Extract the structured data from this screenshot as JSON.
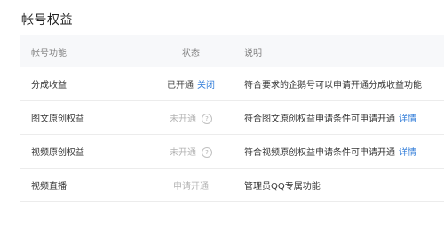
{
  "page": {
    "title": "帐号权益"
  },
  "table": {
    "headers": {
      "feature": "帐号功能",
      "status": "状态",
      "description": "说明"
    },
    "rows": [
      {
        "feature": "分成收益",
        "status": "已开通",
        "action": "关闭",
        "description": "符合要求的企鹅号可以申请开通分成收益功能"
      },
      {
        "feature": "图文原创权益",
        "status": "未开通",
        "help_icon": "question-circle-icon",
        "description": "符合图文原创权益申请条件可申请开通",
        "detail_link": "详情"
      },
      {
        "feature": "视频原创权益",
        "status": "未开通",
        "help_icon": "question-circle-icon",
        "description": "符合视频原创权益申请条件可申请开通",
        "detail_link": "详情"
      },
      {
        "feature": "视频直播",
        "status": "申请开通",
        "description": "管理员QQ专属功能"
      }
    ]
  },
  "colors": {
    "link": "#2f7bd8",
    "header_bg": "#f7f8fa",
    "muted": "#b3b3b3"
  }
}
